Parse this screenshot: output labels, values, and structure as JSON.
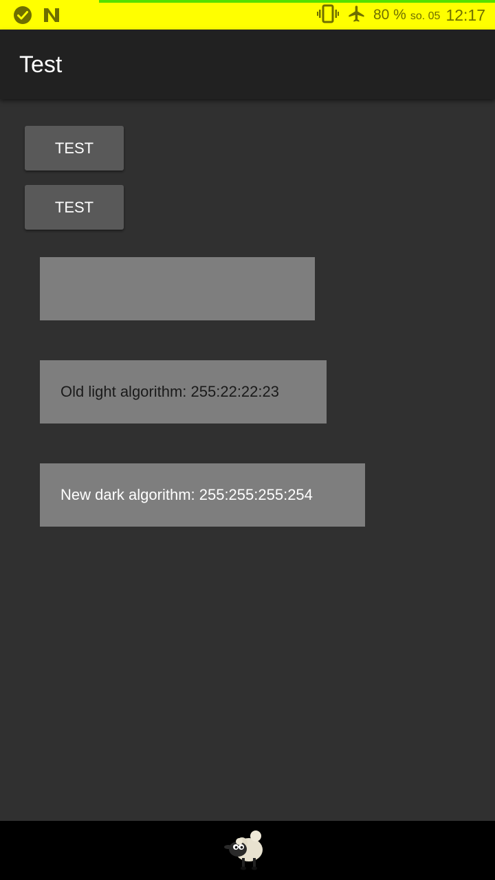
{
  "status_bar": {
    "battery": "80 %",
    "date": "so. 05",
    "time": "12:17",
    "icons": [
      "check-circle-icon",
      "n-icon",
      "vibrate-icon",
      "airplane-icon"
    ],
    "background": "#ffff00"
  },
  "app_bar": {
    "title": "Test"
  },
  "buttons": [
    {
      "label": "TEST"
    },
    {
      "label": "TEST"
    }
  ],
  "boxes": {
    "empty": "",
    "old_light": "Old light algorithm: 255:22:22:23",
    "new_dark": "New dark algorithm: 255:255:255:254"
  },
  "nav_bar": {
    "icon": "sheep-mascot-icon"
  }
}
